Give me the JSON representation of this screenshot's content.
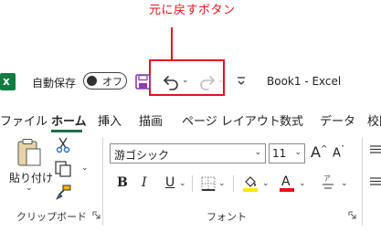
{
  "annotation": {
    "text": "元に戻すボタン",
    "color": "#e8111b"
  },
  "qat": {
    "autosave_label": "自動保存",
    "autosave_state": "オフ",
    "document_title": "Book1  -  Excel",
    "icons": [
      "excel-logo-icon",
      "save-icon",
      "undo-icon",
      "redo-icon",
      "customize-qat-icon"
    ]
  },
  "tabs": [
    {
      "label": "ファイル",
      "active": false
    },
    {
      "label": "ホーム",
      "active": true
    },
    {
      "label": "挿入",
      "active": false
    },
    {
      "label": "描画",
      "active": false
    },
    {
      "label": "ページ レイアウト",
      "active": false
    },
    {
      "label": "数式",
      "active": false
    },
    {
      "label": "データ",
      "active": false
    },
    {
      "label": "校閲",
      "active": false
    }
  ],
  "ribbon": {
    "clipboard": {
      "paste_label": "貼り付け",
      "group_label": "クリップボード"
    },
    "font": {
      "font_name": "游ゴシック",
      "font_size": "11",
      "grow_label": "A",
      "shrink_label": "A",
      "bold": "B",
      "italic": "I",
      "underline": "U",
      "font_color_glyph": "A",
      "phonetic_glyph": "ア",
      "group_label": "フォント"
    }
  },
  "colors": {
    "accent_green": "#1a7343",
    "excel_green": "#107c41",
    "fill_highlight": "#ffe600",
    "font_color": "#e8111b",
    "save_icon": "#8f3bab"
  }
}
